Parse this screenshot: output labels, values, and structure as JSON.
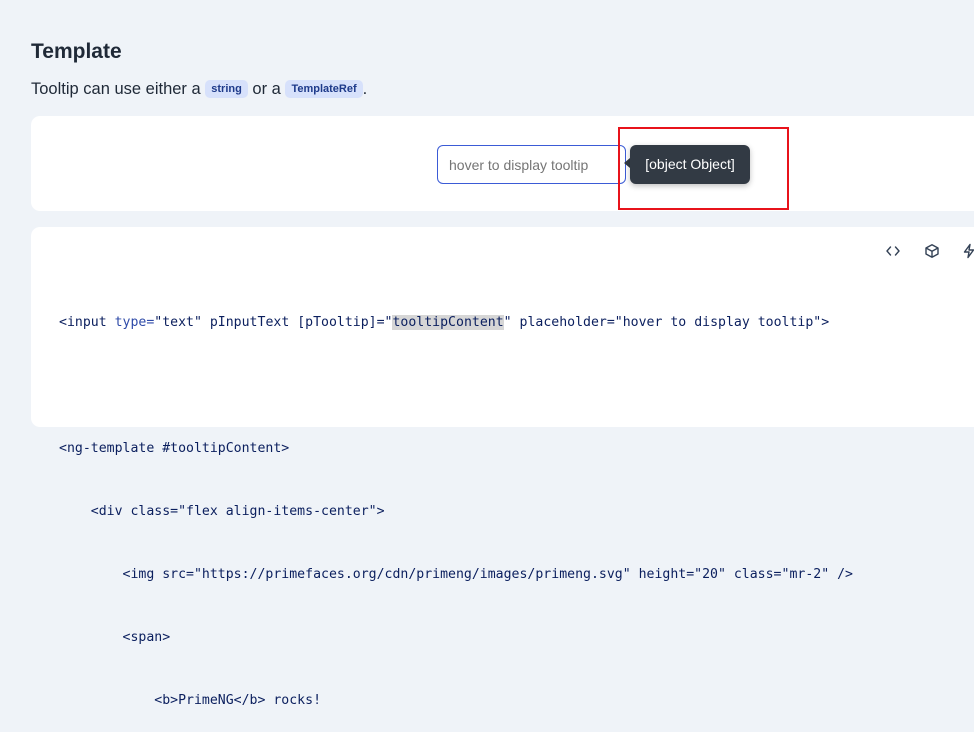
{
  "section": {
    "title": "Template",
    "desc_before": "Tooltip can use either a ",
    "chip_string": "string",
    "desc_mid": " or a ",
    "chip_template": "TemplateRef",
    "desc_after": "."
  },
  "demo": {
    "input_placeholder": "hover to display tooltip",
    "tooltip_text": "[object Object]"
  },
  "toolbar": {
    "icons": [
      "code-icon",
      "box-icon",
      "bolt-icon"
    ]
  },
  "code": {
    "line1_a": "<input ",
    "line1_type_attr": "type=",
    "line1_type_val": "\"text\"",
    "line1_b": " pInputText [pTooltip]=\"",
    "line1_sel": "tooltipContent",
    "line1_c": "\" placeholder=\"hover to display tooltip\">",
    "line2": "<ng-template #tooltipContent>",
    "line3": "    <div class=\"flex align-items-center\">",
    "line4": "        <img src=\"https://primefaces.org/cdn/primeng/images/primeng.svg\" height=\"20\" class=\"mr-2\" />",
    "line5": "        <span>",
    "line6": "            <b>PrimeNG</b> rocks!"
  },
  "colors": {
    "highlight": "#e8131b",
    "tooltip_bg": "#323a44",
    "input_border": "#3b5bd6",
    "chip_bg": "#d7e1fb"
  }
}
